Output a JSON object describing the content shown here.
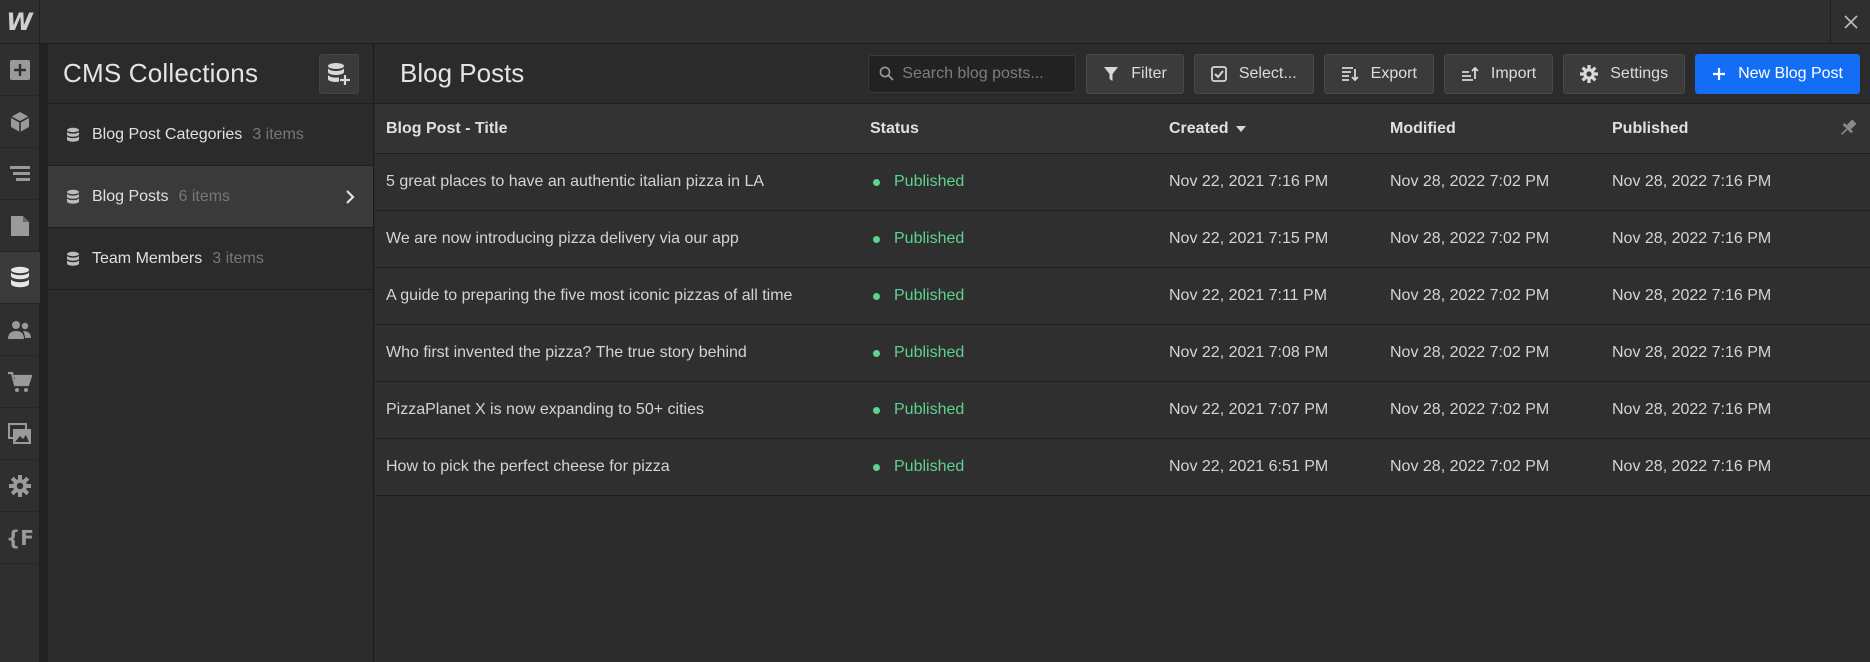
{
  "app": {
    "logo_letter": "W",
    "accent_color": "#146ef5",
    "status_color": "#5ed28e"
  },
  "rail": [
    {
      "icon": "plus-square-icon"
    },
    {
      "icon": "cube-icon"
    },
    {
      "icon": "navigator-icon"
    },
    {
      "icon": "page-icon"
    },
    {
      "icon": "database-icon",
      "active": true
    },
    {
      "icon": "users-icon"
    },
    {
      "icon": "cart-icon"
    },
    {
      "icon": "assets-icon"
    },
    {
      "icon": "gear-icon"
    },
    {
      "icon": "custom-code-icon",
      "label": "{F"
    }
  ],
  "collections": {
    "title": "CMS Collections",
    "items": [
      {
        "name": "Blog Post Categories",
        "count": "3 items"
      },
      {
        "name": "Blog Posts",
        "count": "6 items"
      },
      {
        "name": "Team Members",
        "count": "3 items"
      }
    ]
  },
  "main": {
    "title": "Blog Posts",
    "search_placeholder": "Search blog posts...",
    "buttons": {
      "filter": "Filter",
      "select": "Select...",
      "export": "Export",
      "import": "Import",
      "settings": "Settings",
      "new": "New Blog Post"
    }
  },
  "table": {
    "columns": [
      "Blog Post - Title",
      "Status",
      "Created",
      "Modified",
      "Published"
    ],
    "rows": [
      {
        "title": "5 great places to have an authentic italian pizza in LA",
        "status": "Published",
        "created": "Nov 22, 2021 7:16 PM",
        "modified": "Nov 28, 2022 7:02 PM",
        "published": "Nov 28, 2022 7:16 PM"
      },
      {
        "title": "We are now introducing pizza delivery via our app",
        "status": "Published",
        "created": "Nov 22, 2021 7:15 PM",
        "modified": "Nov 28, 2022 7:02 PM",
        "published": "Nov 28, 2022 7:16 PM"
      },
      {
        "title": "A guide to preparing the five most iconic pizzas of all time",
        "status": "Published",
        "created": "Nov 22, 2021 7:11 PM",
        "modified": "Nov 28, 2022 7:02 PM",
        "published": "Nov 28, 2022 7:16 PM"
      },
      {
        "title": "Who first invented the pizza? The true story behind",
        "status": "Published",
        "created": "Nov 22, 2021 7:08 PM",
        "modified": "Nov 28, 2022 7:02 PM",
        "published": "Nov 28, 2022 7:16 PM"
      },
      {
        "title": "PizzaPlanet X is now expanding to 50+ cities",
        "status": "Published",
        "created": "Nov 22, 2021 7:07 PM",
        "modified": "Nov 28, 2022 7:02 PM",
        "published": "Nov 28, 2022 7:16 PM"
      },
      {
        "title": "How to pick the perfect cheese for pizza",
        "status": "Published",
        "created": "Nov 22, 2021 6:51 PM",
        "modified": "Nov 28, 2022 7:02 PM",
        "published": "Nov 28, 2022 7:16 PM"
      }
    ]
  }
}
